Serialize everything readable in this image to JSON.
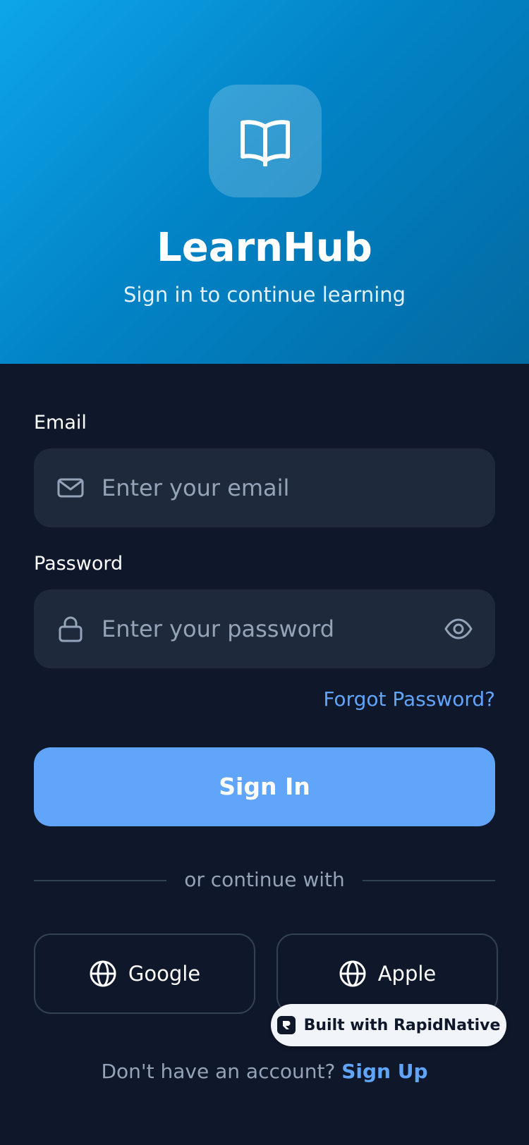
{
  "header": {
    "logo_icon": "open-book-icon",
    "title": "LearnHub",
    "subtitle": "Sign in to continue learning"
  },
  "form": {
    "email": {
      "label": "Email",
      "placeholder": "Enter your email",
      "icon": "mail-icon"
    },
    "password": {
      "label": "Password",
      "placeholder": "Enter your password",
      "icon": "lock-icon",
      "toggle_icon": "eye-icon"
    },
    "forgot_label": "Forgot Password?",
    "submit_label": "Sign In"
  },
  "divider": {
    "text": "or continue with"
  },
  "social": [
    {
      "label": "Google",
      "icon": "globe-icon"
    },
    {
      "label": "Apple",
      "icon": "globe-icon"
    }
  ],
  "footer": {
    "prompt": "Don't have an account?",
    "link": "Sign Up"
  },
  "badge": {
    "label": "Built with RapidNative"
  },
  "colors": {
    "background": "#0f172a",
    "header_gradient_start": "#0ea5e9",
    "header_gradient_end": "#0369a1",
    "input_bg": "#1e293b",
    "accent": "#60a5fa",
    "muted_text": "#94a3b8",
    "border": "#334155"
  }
}
